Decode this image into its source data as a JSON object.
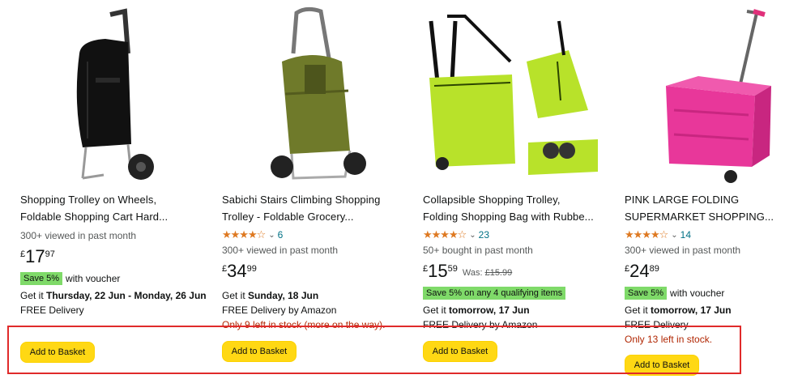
{
  "products": [
    {
      "title_lines": [
        "Shopping Trolley on Wheels,",
        "Foldable Shopping Cart Hard..."
      ],
      "rating": null,
      "viewed": "300+ viewed in past month",
      "price": {
        "currency": "£",
        "whole": "17",
        "fraction": "97",
        "was_label": "",
        "was_value": ""
      },
      "badge": "Save 5%",
      "badge_suffix": "with voucher",
      "delivery_prefix": "Get it ",
      "delivery_date": "Thursday, 22 Jun - Monday, 26 Jun",
      "free_delivery": "FREE Delivery",
      "stock": "",
      "button_label": "Add to Basket",
      "image_icon": "black-shopping-trolley-image"
    },
    {
      "title_lines": [
        "Sabichi Stairs Climbing Shopping",
        "Trolley - Foldable Grocery..."
      ],
      "rating": {
        "stars": "★★★★☆",
        "count": "6",
        "value": 4.5
      },
      "viewed": "300+ viewed in past month",
      "price": {
        "currency": "£",
        "whole": "34",
        "fraction": "99",
        "was_label": "",
        "was_value": ""
      },
      "badge": "",
      "badge_suffix": "",
      "delivery_prefix": "Get it ",
      "delivery_date": "Sunday, 18 Jun",
      "free_delivery": "FREE Delivery by Amazon",
      "stock": "Only 9 left in stock (more on the way).",
      "button_label": "Add to Basket",
      "image_icon": "green-stair-climbing-trolley-image"
    },
    {
      "title_lines": [
        "Collapsible Shopping Trolley,",
        "Folding Shopping Bag with Rubbe..."
      ],
      "rating": {
        "stars": "★★★★☆",
        "count": "23",
        "value": 4.5
      },
      "viewed": "50+ bought in past month",
      "price": {
        "currency": "£",
        "whole": "15",
        "fraction": "59",
        "was_label": "Was:",
        "was_value": "£15.99"
      },
      "badge": "Save 5% on any 4 qualifying items",
      "badge_suffix": "",
      "delivery_prefix": "Get it ",
      "delivery_date": "tomorrow, 17 Jun",
      "free_delivery": "FREE Delivery by Amazon",
      "stock": "",
      "button_label": "Add to Basket",
      "image_icon": "lime-collapsible-trolley-image"
    },
    {
      "title_lines": [
        "PINK LARGE FOLDING",
        "SUPERMARKET SHOPPING..."
      ],
      "rating": {
        "stars": "★★★★☆",
        "count": "14",
        "value": 4.0
      },
      "viewed": "300+ viewed in past month",
      "price": {
        "currency": "£",
        "whole": "24",
        "fraction": "89",
        "was_label": "",
        "was_value": ""
      },
      "badge": "Save 5%",
      "badge_suffix": "with voucher",
      "delivery_prefix": "Get it ",
      "delivery_date": "tomorrow, 17 Jun",
      "free_delivery": "FREE Delivery",
      "stock": "Only 13 left in stock.",
      "button_label": "Add to Basket",
      "image_icon": "pink-folding-crate-trolley-image"
    }
  ],
  "colors": {
    "button": "#ffd814",
    "badge": "#7fda69",
    "stars": "#de7921",
    "link": "#007185",
    "stock_warning": "#b12704",
    "highlight_box": "#e02a2a"
  }
}
